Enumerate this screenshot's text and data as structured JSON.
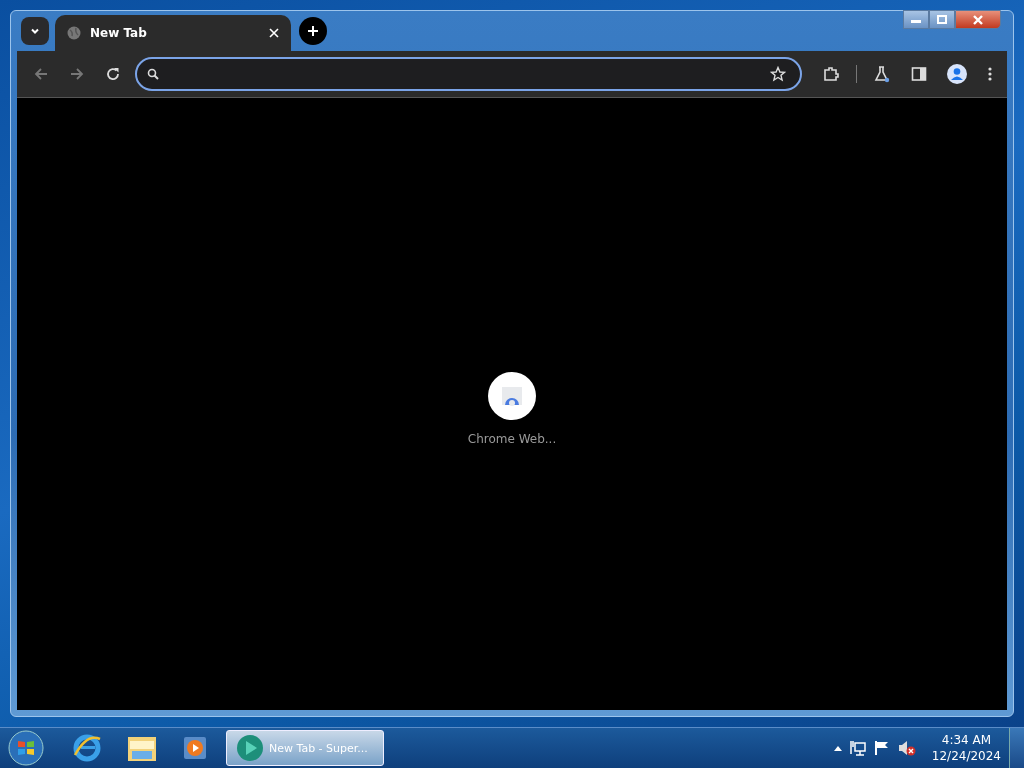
{
  "browser": {
    "tabs": [
      {
        "title": "New Tab",
        "selected": true
      }
    ],
    "shortcut": {
      "label": "Chrome Web..."
    }
  },
  "taskbar": {
    "windows": [
      {
        "label": "New Tab - Super...",
        "selected": true
      }
    ],
    "clock": {
      "time": "4:34 AM",
      "date": "12/24/2024"
    }
  }
}
